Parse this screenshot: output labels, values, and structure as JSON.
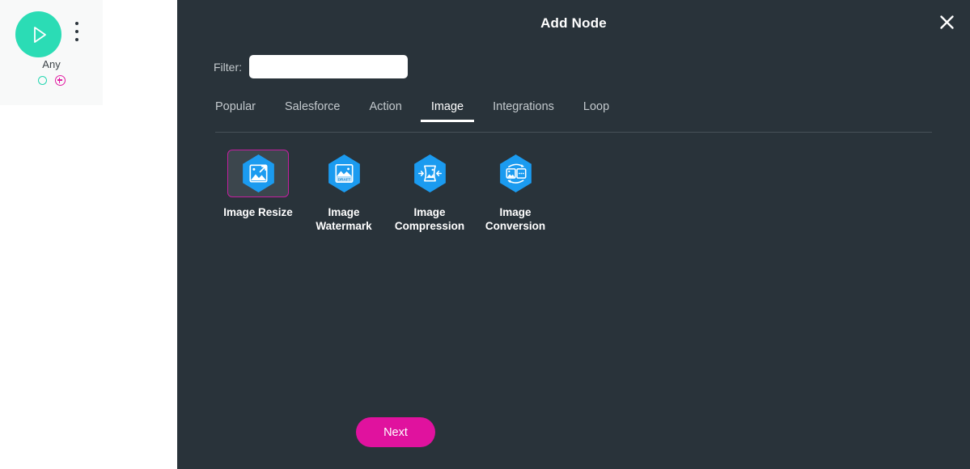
{
  "canvas": {
    "node": {
      "label": "Any",
      "play_icon": "play-triangle-icon",
      "menu_icon": "kebab-menu-icon",
      "output_port_icon": "output-port-circle-icon",
      "add_port_icon": "add-port-plus-icon",
      "accent_color": "#2bdcb5",
      "add_color": "#e21ba2"
    }
  },
  "modal": {
    "title": "Add Node",
    "close_icon": "close-x-icon",
    "background_color": "#29333a",
    "filter": {
      "label": "Filter:",
      "value": "",
      "placeholder": ""
    },
    "tabs": [
      {
        "label": "Popular",
        "active": false
      },
      {
        "label": "Salesforce",
        "active": false
      },
      {
        "label": "Action",
        "active": false
      },
      {
        "label": "Image",
        "active": true
      },
      {
        "label": "Integrations",
        "active": false
      },
      {
        "label": "Loop",
        "active": false
      }
    ],
    "tiles": [
      {
        "label": "Image Resize",
        "icon": "image-resize-hexagon-icon",
        "selected": true
      },
      {
        "label": "Image Watermark",
        "icon": "image-watermark-hexagon-icon",
        "selected": false
      },
      {
        "label": "Image Compression",
        "icon": "image-compression-hexagon-icon",
        "selected": false
      },
      {
        "label": "Image Conversion",
        "icon": "image-conversion-hexagon-icon",
        "selected": false
      }
    ],
    "tile_icon_color": "#1b9bf0",
    "selected_border_color": "#c41fa0",
    "next_button": {
      "label": "Next",
      "color": "#e0129e"
    }
  }
}
